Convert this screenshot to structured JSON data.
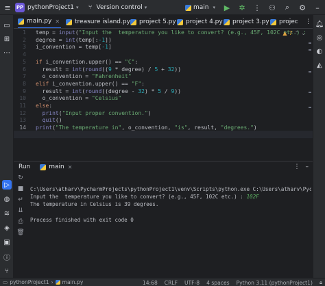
{
  "titlebar": {
    "project_badge": "PP",
    "project_name": "pythonProject1",
    "vcs_label": "Version control",
    "run_config": "main",
    "menu_icon": "hamburger-menu-icon"
  },
  "tabs": [
    {
      "label": "main.py",
      "active": true
    },
    {
      "label": "treasure island.py",
      "active": false
    },
    {
      "label": "project 5.py",
      "active": false
    },
    {
      "label": "project 4.py",
      "active": false
    },
    {
      "label": "project 3.py",
      "active": false
    },
    {
      "label": "projec",
      "active": false
    }
  ],
  "editor": {
    "line_numbers": [
      "1",
      "2",
      "3",
      "4",
      "5",
      "6",
      "7",
      "8",
      "9",
      "10",
      "11",
      "12",
      "13",
      "14"
    ],
    "current_line": "14",
    "warning_count": "7",
    "code_lines": [
      [
        [
          "pu",
          "temp = "
        ],
        [
          "bi",
          "input"
        ],
        [
          "pu",
          "("
        ],
        [
          "st",
          "\"Input the  temperature you like to convert? (e.g., 45F, 102C etc.) : \""
        ],
        [
          "pu",
          ")"
        ]
      ],
      [
        [
          "pu",
          "degree = "
        ],
        [
          "bi",
          "int"
        ],
        [
          "pu",
          "(temp[:"
        ],
        [
          "nu",
          "-1"
        ],
        [
          "pu",
          "])"
        ]
      ],
      [
        [
          "pu",
          "i_convention = temp["
        ],
        [
          "nu",
          "-1"
        ],
        [
          "pu",
          "]"
        ]
      ],
      [],
      [
        [
          "kw",
          "if "
        ],
        [
          "pu",
          "i_convention.upper() == "
        ],
        [
          "st",
          "\"C\""
        ],
        [
          "pu",
          ":"
        ]
      ],
      [
        [
          "pu",
          "  result = "
        ],
        [
          "bi",
          "int"
        ],
        [
          "pu",
          "("
        ],
        [
          "bi",
          "round"
        ],
        [
          "pu",
          "(("
        ],
        [
          "nu",
          "9"
        ],
        [
          "pu",
          " * degree) / "
        ],
        [
          "nu",
          "5"
        ],
        [
          "pu",
          " + "
        ],
        [
          "nu",
          "32"
        ],
        [
          "pu",
          "))"
        ]
      ],
      [
        [
          "pu",
          "  o_convention = "
        ],
        [
          "st",
          "\"Fahrenheit\""
        ]
      ],
      [
        [
          "kw",
          "elif "
        ],
        [
          "pu",
          "i_convention.upper() == "
        ],
        [
          "st",
          "\"F\""
        ],
        [
          "pu",
          ":"
        ]
      ],
      [
        [
          "pu",
          "  result = "
        ],
        [
          "bi",
          "int"
        ],
        [
          "pu",
          "("
        ],
        [
          "bi",
          "round"
        ],
        [
          "pu",
          "((degree - "
        ],
        [
          "nu",
          "32"
        ],
        [
          "pu",
          ") * "
        ],
        [
          "nu",
          "5"
        ],
        [
          "pu",
          " / "
        ],
        [
          "nu",
          "9"
        ],
        [
          "pu",
          "))"
        ]
      ],
      [
        [
          "pu",
          "  o_convention = "
        ],
        [
          "st",
          "\"Celsius\""
        ]
      ],
      [
        [
          "kw",
          "else"
        ],
        [
          "pu",
          ":"
        ]
      ],
      [
        [
          "pu",
          "  "
        ],
        [
          "bi",
          "print"
        ],
        [
          "pu",
          "("
        ],
        [
          "st",
          "\"Input proper convention.\""
        ],
        [
          "pu",
          ")"
        ]
      ],
      [
        [
          "pu",
          "  "
        ],
        [
          "bi",
          "quit"
        ],
        [
          "pu",
          "()"
        ]
      ],
      [
        [
          "bi",
          "print"
        ],
        [
          "pu",
          "("
        ],
        [
          "st",
          "\"The temperature in\""
        ],
        [
          "pu",
          ", o_convention, "
        ],
        [
          "st",
          "\"is\""
        ],
        [
          "pu",
          ", result, "
        ],
        [
          "st",
          "\"degrees.\""
        ],
        [
          "pu",
          ")"
        ]
      ]
    ]
  },
  "run": {
    "title": "Run",
    "tab_label": "main",
    "console": {
      "command": "C:\\Users\\atharv\\PycharmProjects\\pythonProject1\\venv\\Scripts\\python.exe C:\\Users\\atharv\\PycharmProjects\\",
      "prompt": "Input the  temperature you like to convert? (e.g., 45F, 102C etc.) : ",
      "user_input": "102F",
      "result": "The temperature in Celsius is 39 degrees.",
      "exit": "Process finished with exit code 0"
    }
  },
  "statusbar": {
    "project": "pythonProject1",
    "file": "main.py",
    "position": "14:68",
    "line_sep": "CRLF",
    "encoding": "UTF-8",
    "indent": "4 spaces",
    "interpreter": "Python 3.11 (pythonProject1)"
  },
  "colors": {
    "accent": "#3574f0",
    "background": "#1e1f22",
    "panel": "#2b2d30",
    "string": "#6aab73",
    "keyword": "#cf8e6d",
    "number": "#2aacb8",
    "builtin": "#8888c6"
  }
}
